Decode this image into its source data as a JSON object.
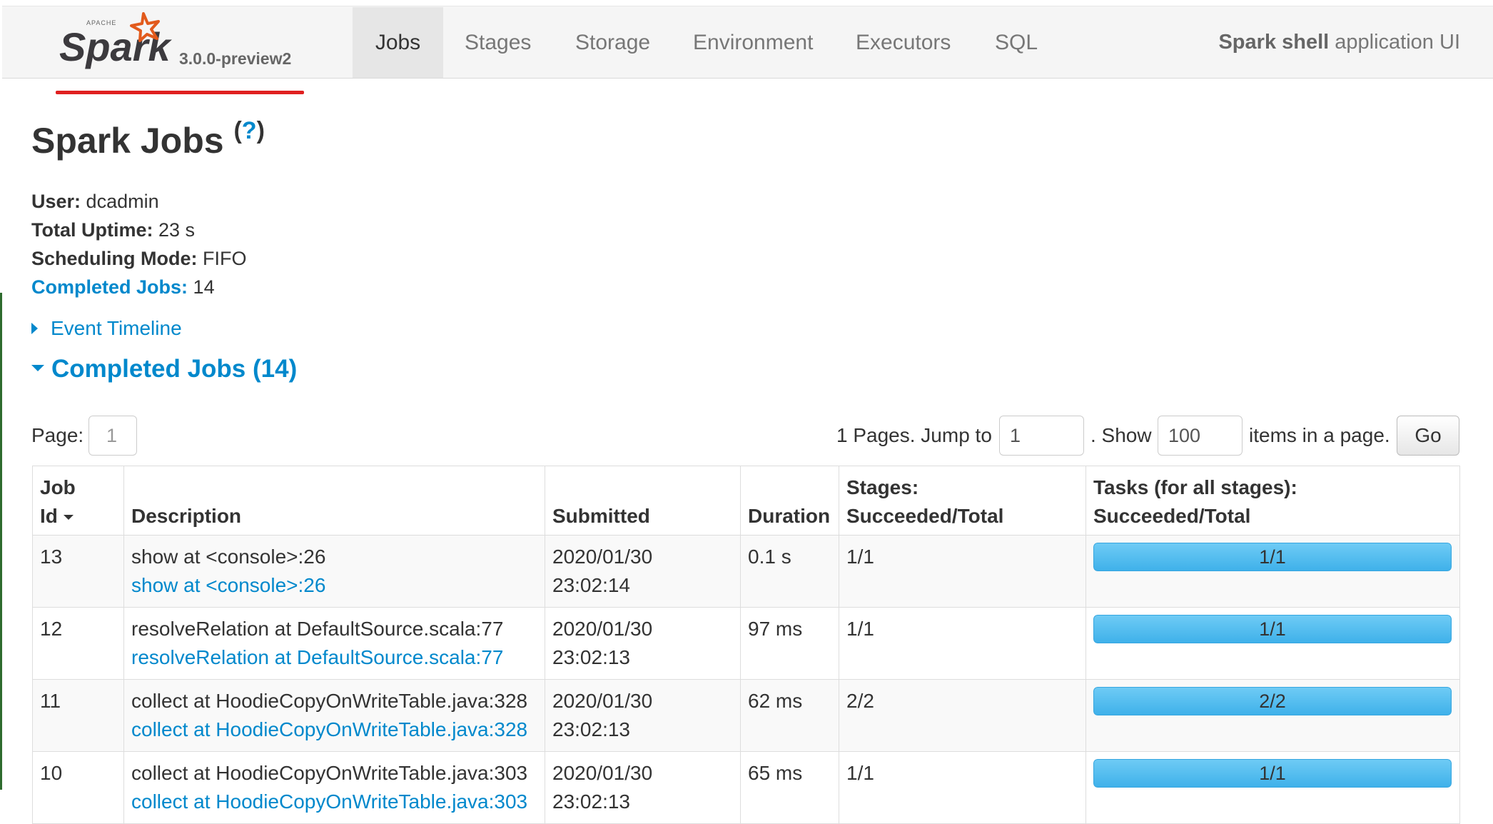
{
  "navbar": {
    "logo_top_text": "APACHE",
    "logo_text": "Spark",
    "version": "3.0.0-preview2",
    "tabs": [
      {
        "label": "Jobs",
        "active": true
      },
      {
        "label": "Stages",
        "active": false
      },
      {
        "label": "Storage",
        "active": false
      },
      {
        "label": "Environment",
        "active": false
      },
      {
        "label": "Executors",
        "active": false
      },
      {
        "label": "SQL",
        "active": false
      }
    ],
    "app_name": "Spark shell",
    "app_suffix": "application UI"
  },
  "page": {
    "title": "Spark Jobs",
    "help": "?"
  },
  "summary": {
    "user_label": "User:",
    "user_value": "dcadmin",
    "uptime_label": "Total Uptime:",
    "uptime_value": "23 s",
    "sched_label": "Scheduling Mode:",
    "sched_value": "FIFO",
    "completed_label": "Completed Jobs:",
    "completed_value": "14"
  },
  "event_timeline": "Event Timeline",
  "section_title": "Completed Jobs (14)",
  "pager": {
    "page_label": "Page:",
    "page_value": "1",
    "pages_text": "1 Pages. Jump to",
    "jump_value": "1",
    "show_text": ". Show",
    "show_value": "100",
    "items_text": "items in a page.",
    "go_label": "Go"
  },
  "table": {
    "headers": {
      "job_id_1": "Job",
      "job_id_2": "Id",
      "description": "Description",
      "submitted": "Submitted",
      "duration": "Duration",
      "stages_1": "Stages:",
      "stages_2": "Succeeded/Total",
      "tasks_1": "Tasks (for all stages):",
      "tasks_2": "Succeeded/Total"
    },
    "rows": [
      {
        "id": "13",
        "desc": "show at <console>:26",
        "desc_link": "show at <console>:26",
        "date": "2020/01/30",
        "time": "23:02:14",
        "duration": "0.1 s",
        "stages": "1/1",
        "tasks": "1/1",
        "progress": 1.0
      },
      {
        "id": "12",
        "desc": "resolveRelation at DefaultSource.scala:77",
        "desc_link": "resolveRelation at DefaultSource.scala:77",
        "date": "2020/01/30",
        "time": "23:02:13",
        "duration": "97 ms",
        "stages": "1/1",
        "tasks": "1/1",
        "progress": 1.0
      },
      {
        "id": "11",
        "desc": "collect at HoodieCopyOnWriteTable.java:328",
        "desc_link": "collect at HoodieCopyOnWriteTable.java:328",
        "date": "2020/01/30",
        "time": "23:02:13",
        "duration": "62 ms",
        "stages": "2/2",
        "tasks": "2/2",
        "progress": 1.0
      },
      {
        "id": "10",
        "desc": "collect at HoodieCopyOnWriteTable.java:303",
        "desc_link": "collect at HoodieCopyOnWriteTable.java:303",
        "date": "2020/01/30",
        "time": "23:02:13",
        "duration": "65 ms",
        "stages": "1/1",
        "tasks": "1/1",
        "progress": 1.0
      }
    ]
  },
  "colors": {
    "link": "#0088cc",
    "progress_fill": "#3fb1ea",
    "annotation_underline": "#e02020"
  }
}
